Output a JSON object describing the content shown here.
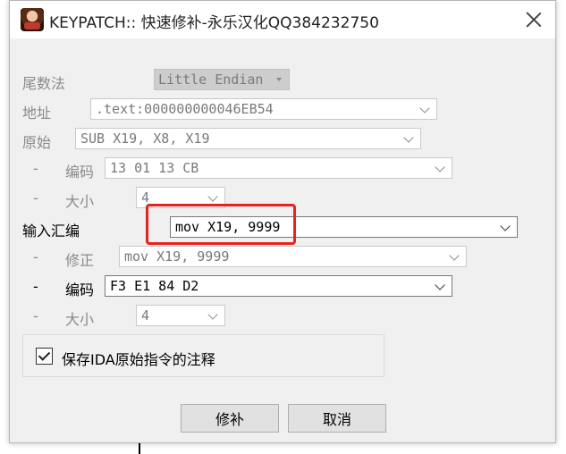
{
  "window": {
    "title": "KEYPATCH:: 快速修补-永乐汉化QQ384232750",
    "icon": "app-avatar-icon",
    "close_icon": "close-icon"
  },
  "fields": {
    "endian": {
      "label": "尾数法",
      "value": "Little Endian"
    },
    "address": {
      "label": "地址",
      "value": ".text:000000000046EB54"
    },
    "original": {
      "label": "原始",
      "value": "SUB X19, X8, X19"
    },
    "orig_encoding": {
      "dash": "-",
      "label": "编码",
      "value": "13 01 13 CB"
    },
    "orig_size": {
      "dash": "-",
      "label": "大小",
      "value": "4"
    },
    "assembly": {
      "label": "输入汇编",
      "value": "mov X19, 9999"
    },
    "fixup": {
      "dash": "-",
      "label": "修正",
      "value": "mov X19, 9999"
    },
    "new_encoding": {
      "dash": "-",
      "label": "编码",
      "value": "F3 E1 84 D2"
    },
    "new_size": {
      "dash": "-",
      "label": "大小",
      "value": "4"
    }
  },
  "options": {
    "save_comment": {
      "label": "保存IDA原始指令的注释",
      "checked": true
    }
  },
  "buttons": {
    "patch": "修补",
    "cancel": "取消"
  },
  "background": {
    "text_prefix": ".text:00000000004",
    "text_mid": "6EB54 ",
    "hex_green": "F3 E1 84 D2",
    "hex_blue": ""
  },
  "colors": {
    "highlight": "#e8231e",
    "dialog_bg": "#f0f0f0"
  }
}
